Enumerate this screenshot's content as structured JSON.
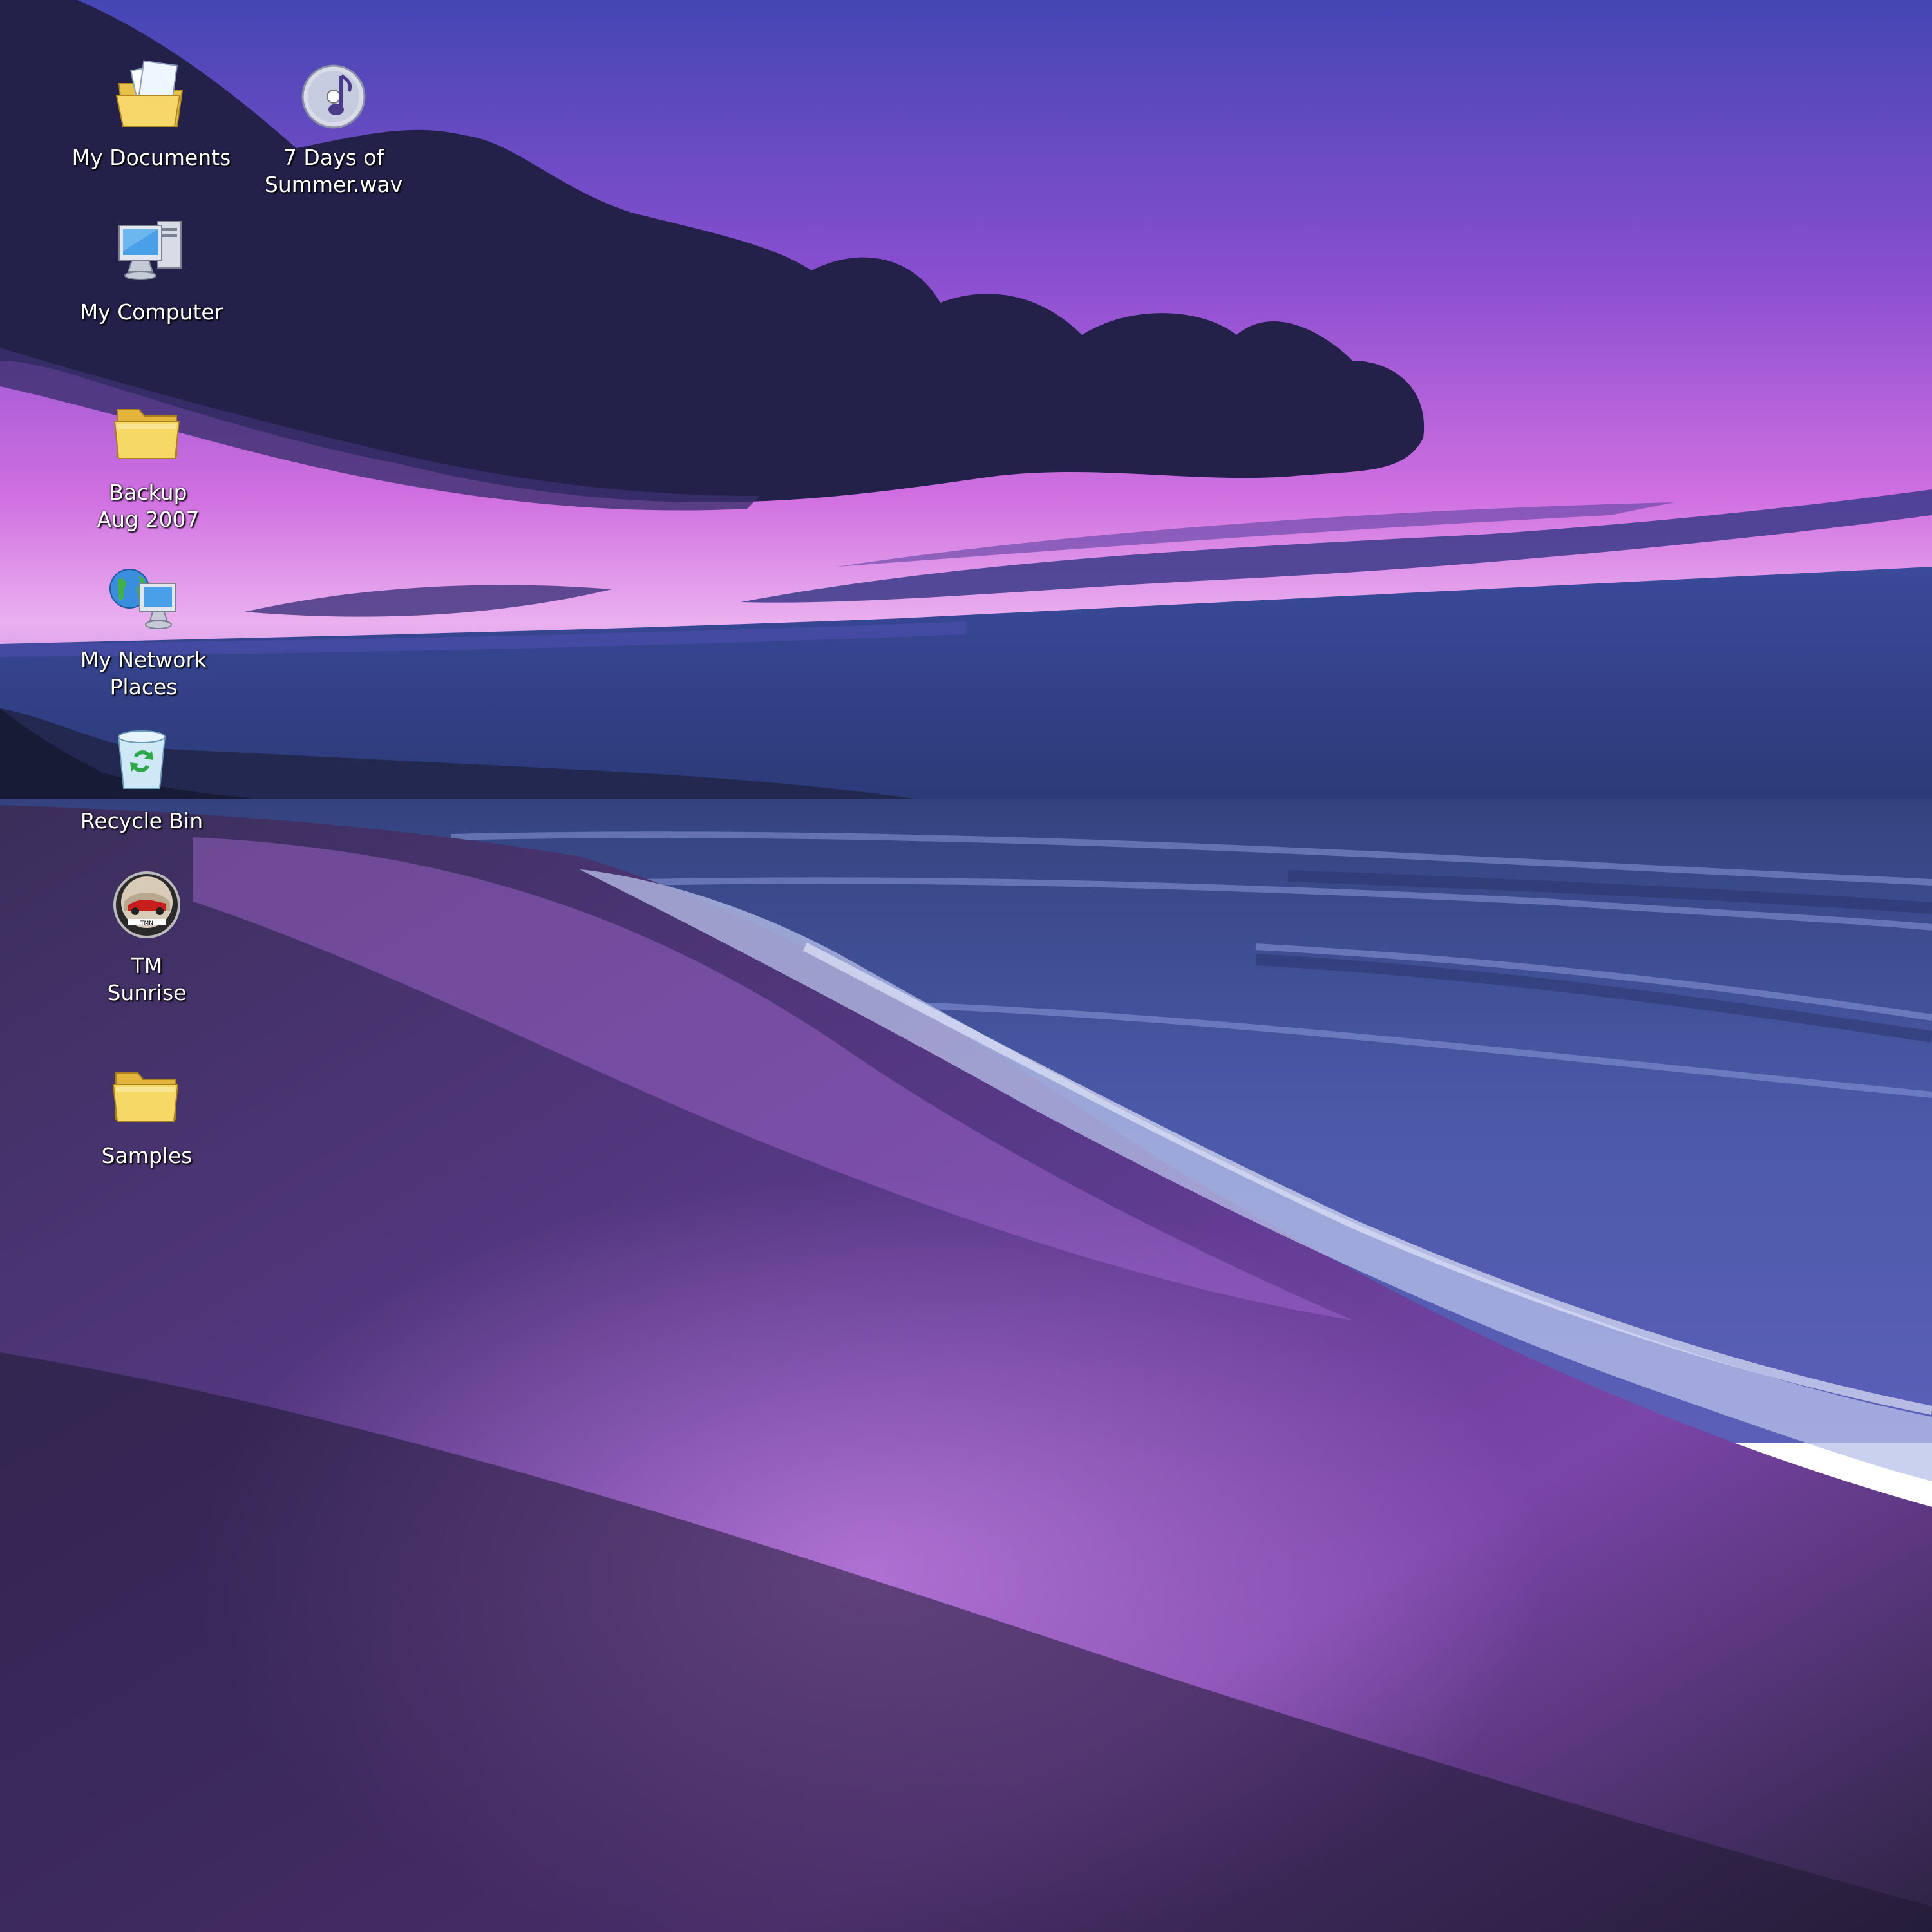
{
  "desktop": {
    "wallpaper": {
      "description_colors": {
        "sky_top": "#4a4fb8",
        "sky_mid": "#b05ad8",
        "horizon_glow": "#e9a8ec",
        "cloud": "#24224a",
        "sea": "#3d4f9a",
        "foam": "#b9c3e8",
        "sand_wet": "#8a55b8",
        "sand_dark": "#2b2440"
      }
    },
    "icons": [
      {
        "id": "my-documents",
        "label": "My Documents",
        "icon": "documents-folder-icon"
      },
      {
        "id": "seven-days-wav",
        "label": "7 Days of\nSummer.wav",
        "icon": "audio-file-icon"
      },
      {
        "id": "my-computer",
        "label": "My Computer",
        "icon": "computer-icon"
      },
      {
        "id": "backup-aug-2007",
        "label": "Backup\nAug 2007",
        "icon": "folder-icon"
      },
      {
        "id": "my-network-places",
        "label": "My Network\nPlaces",
        "icon": "network-icon"
      },
      {
        "id": "recycle-bin",
        "label": "Recycle Bin",
        "icon": "recycle-bin-icon"
      },
      {
        "id": "tm-sunrise",
        "label": "TM\nSunrise",
        "icon": "game-icon"
      },
      {
        "id": "samples",
        "label": "Samples",
        "icon": "folder-icon"
      }
    ]
  }
}
